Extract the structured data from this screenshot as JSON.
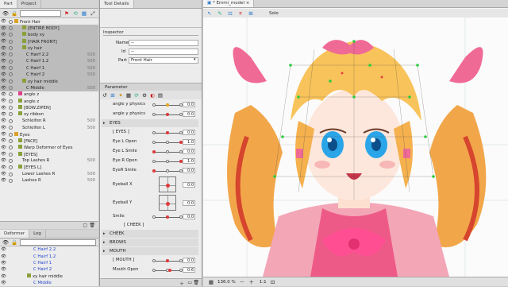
{
  "part_panel": {
    "tabs": [
      "Part",
      "Project"
    ],
    "items": [
      {
        "label": "Front Hair",
        "indent": 0,
        "type": "folder",
        "num": "",
        "sel": false,
        "blue": false
      },
      {
        "label": "[ENTIRE BODY]",
        "indent": 2,
        "type": "g",
        "num": "",
        "sel": true,
        "blue": false
      },
      {
        "label": "body xy",
        "indent": 2,
        "type": "g",
        "num": "",
        "sel": true,
        "blue": false
      },
      {
        "label": "[HAIR FRONT]",
        "indent": 2,
        "type": "g",
        "num": "",
        "sel": true,
        "blue": false
      },
      {
        "label": "xy hair",
        "indent": 2,
        "type": "g",
        "num": "",
        "sel": true,
        "blue": false
      },
      {
        "label": "C Hairf 2.2",
        "indent": 3,
        "type": "",
        "num": "500",
        "sel": true,
        "blue": false
      },
      {
        "label": "C Hairf 1.2",
        "indent": 3,
        "type": "",
        "num": "500",
        "sel": true,
        "blue": false
      },
      {
        "label": "C Hairf 1",
        "indent": 3,
        "type": "",
        "num": "500",
        "sel": true,
        "blue": false
      },
      {
        "label": "C Hairf 2",
        "indent": 3,
        "type": "",
        "num": "500",
        "sel": true,
        "blue": false
      },
      {
        "label": "xy hair middle",
        "indent": 2,
        "type": "g",
        "num": "",
        "sel": true,
        "blue": false
      },
      {
        "label": "C Middle",
        "indent": 3,
        "type": "",
        "num": "500",
        "sel": true,
        "blue": false
      },
      {
        "label": "angle z",
        "indent": 1,
        "type": "p",
        "num": "",
        "sel": false,
        "blue": false
      },
      {
        "label": "angle z",
        "indent": 1,
        "type": "g",
        "num": "",
        "sel": false,
        "blue": false
      },
      {
        "label": "[BOW.ZIPEN]",
        "indent": 1,
        "type": "g",
        "num": "",
        "sel": false,
        "blue": false
      },
      {
        "label": "xy ribbon",
        "indent": 1,
        "type": "g",
        "num": "",
        "sel": false,
        "blue": false
      },
      {
        "label": "Schleifen R",
        "indent": 2,
        "type": "",
        "num": "500",
        "sel": false,
        "blue": false
      },
      {
        "label": "Schleifen L",
        "indent": 2,
        "type": "",
        "num": "500",
        "sel": false,
        "blue": false
      },
      {
        "label": "Eyes",
        "indent": 0,
        "type": "folder",
        "num": "",
        "sel": false,
        "blue": false
      },
      {
        "label": "[FACE]",
        "indent": 1,
        "type": "g",
        "num": "",
        "sel": false,
        "blue": false
      },
      {
        "label": "Warp Deformer of Eyes",
        "indent": 1,
        "type": "g",
        "num": "",
        "sel": false,
        "blue": false
      },
      {
        "label": "[EYES]",
        "indent": 1,
        "type": "g",
        "num": "",
        "sel": false,
        "blue": false
      },
      {
        "label": "Top Lashes R",
        "indent": 2,
        "type": "",
        "num": "500",
        "sel": false,
        "blue": false
      },
      {
        "label": "[EYES L]",
        "indent": 1,
        "type": "g",
        "num": "",
        "sel": false,
        "blue": false
      },
      {
        "label": "Lower Lashes R",
        "indent": 2,
        "type": "",
        "num": "500",
        "sel": false,
        "blue": false
      },
      {
        "label": "Lashes R",
        "indent": 2,
        "type": "",
        "num": "500",
        "sel": false,
        "blue": false
      }
    ]
  },
  "deformer_panel": {
    "tabs": [
      "Deformer",
      "Log"
    ],
    "items": [
      {
        "label": "C Hairf 2.2",
        "indent": 3,
        "blue": true,
        "type": ""
      },
      {
        "label": "C Hairf 1.2",
        "indent": 3,
        "blue": true,
        "type": ""
      },
      {
        "label": "C Hairf 1",
        "indent": 3,
        "blue": true,
        "type": ""
      },
      {
        "label": "C Hairf 2",
        "indent": 3,
        "blue": true,
        "type": ""
      },
      {
        "label": "xy hair middle",
        "indent": 2,
        "blue": false,
        "type": "g"
      },
      {
        "label": "C Middle",
        "indent": 3,
        "blue": true,
        "type": ""
      }
    ]
  },
  "tool_details": {
    "tab": "Tool Details"
  },
  "inspector": {
    "title": "Inspector",
    "name_label": "Name",
    "name_value": "--",
    "id_label": "Id",
    "id_value": "--",
    "part_label": "Part",
    "part_value": "Front Hair"
  },
  "parameter": {
    "title": "Parameter",
    "rows": [
      {
        "label": "angle y physics",
        "value": "0.0",
        "kind": "slider",
        "knob": 0.5,
        "color": "#e8a91a"
      },
      {
        "label": "angle y physics",
        "value": "0.0",
        "kind": "slider",
        "knob": 0.5,
        "color": "#e23a3a"
      },
      {
        "label": "EYES",
        "kind": "section"
      },
      {
        "label": "[ EYES ]",
        "value": "0.0",
        "kind": "slider",
        "knob": 0.5,
        "color": "#e23a3a"
      },
      {
        "label": "Eye L Open",
        "value": "1.0",
        "kind": "slider",
        "knob": 1.0,
        "color": "#e23a3a"
      },
      {
        "label": "Eye L Smile",
        "value": "0.0",
        "kind": "slider",
        "knob": 0.0,
        "color": "#e23a3a"
      },
      {
        "label": "Eye R Open",
        "value": "1.0",
        "kind": "slider",
        "knob": 1.0,
        "color": "#e23a3a"
      },
      {
        "label": "EyeR Smile",
        "value": "0.0",
        "kind": "slider",
        "knob": 0.0,
        "color": "#e23a3a"
      },
      {
        "label": "Eyeball X",
        "value": "0.0",
        "kind": "grid"
      },
      {
        "label": "Eyeball Y",
        "value": "0.0",
        "kind": "gridb"
      },
      {
        "label": "Smile",
        "value": "0.0",
        "kind": "slider",
        "knob": 0.5,
        "color": "#e23a3a"
      },
      {
        "label": "[ CHEEK ]",
        "kind": "divider"
      },
      {
        "label": "CHEEK",
        "kind": "section"
      },
      {
        "label": "BROWS",
        "kind": "section"
      },
      {
        "label": "MOUTH",
        "kind": "section"
      },
      {
        "label": "[ MOUTH ]",
        "value": "0.0",
        "kind": "slider",
        "knob": 0.5,
        "color": "#e23a3a"
      },
      {
        "label": "Mouth Open",
        "value": "0.6",
        "kind": "slider",
        "knob": 0.6,
        "color": "#e23a3a"
      }
    ]
  },
  "viewport": {
    "tab": "* Emmi_model",
    "solo_label": "Solo",
    "zoom": "136.0 %",
    "ratio": "1:1"
  },
  "colors": {
    "accent": "#2c6fd6",
    "part_green": "#8aa13a",
    "selected": "#bcbcbc"
  }
}
